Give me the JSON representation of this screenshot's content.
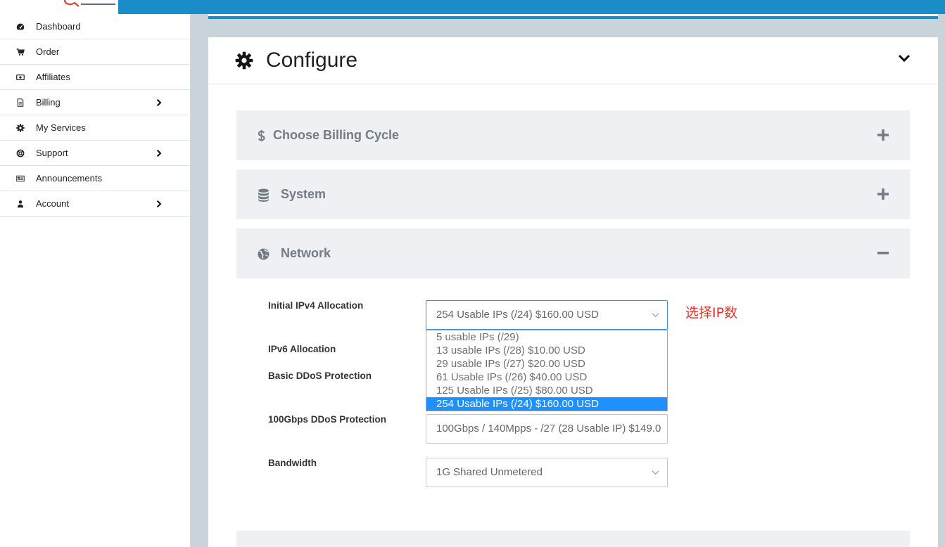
{
  "colors": {
    "topbar": "#1a8cc7",
    "page_bg": "#c9d3da",
    "section_bg": "#eef0f3",
    "section_text": "#737c86",
    "select_focus_border": "#3a8fcf",
    "option_highlight": "#1e90ff",
    "annotation": "#e8302a"
  },
  "sidebar": {
    "items": [
      {
        "label": "Dashboard",
        "icon": "tachometer-icon",
        "has_submenu": false
      },
      {
        "label": "Order",
        "icon": "cart-icon",
        "has_submenu": false
      },
      {
        "label": "Affiliates",
        "icon": "money-icon",
        "has_submenu": false
      },
      {
        "label": "Billing",
        "icon": "file-icon",
        "has_submenu": true
      },
      {
        "label": "My Services",
        "icon": "cog-icon",
        "has_submenu": false
      },
      {
        "label": "Support",
        "icon": "life-ring-icon",
        "has_submenu": true
      },
      {
        "label": "Announcements",
        "icon": "newspaper-icon",
        "has_submenu": false
      },
      {
        "label": "Account",
        "icon": "user-icon",
        "has_submenu": true
      }
    ]
  },
  "configure_panel": {
    "title": "Configure",
    "icon": "gear-icon",
    "toggle_icon": "chevron-down-icon"
  },
  "sections": [
    {
      "title": "Choose Billing Cycle",
      "icon": "dollar-icon",
      "expanded": false,
      "toggle_icon": "plus-icon"
    },
    {
      "title": "System",
      "icon": "database-icon",
      "expanded": false,
      "toggle_icon": "plus-icon"
    },
    {
      "title": "Network",
      "icon": "globe-icon",
      "expanded": true,
      "toggle_icon": "minus-icon"
    }
  ],
  "network": {
    "ipv4": {
      "label": "Initial IPv4 Allocation",
      "value": "254 Usable IPs (/24) $160.00 USD",
      "dropdown_open": true,
      "options": [
        {
          "label": "5 usable IPs (/29)",
          "selected": false
        },
        {
          "label": "13 usable IPs (/28) $10.00 USD",
          "selected": false
        },
        {
          "label": "29 usable IPs (/27) $20.00 USD",
          "selected": false
        },
        {
          "label": "61 Usable IPs (/26) $40.00 USD",
          "selected": false
        },
        {
          "label": "125 Usable IPs (/25) $80.00 USD",
          "selected": false
        },
        {
          "label": "254 Usable IPs (/24) $160.00 USD",
          "selected": true
        }
      ]
    },
    "ipv6": {
      "label": "IPv6 Allocation"
    },
    "basic_ddos": {
      "label": "Basic DDoS Protection"
    },
    "ddos_100g": {
      "label": "100Gbps DDoS Protection",
      "value": "100Gbps / 140Mpps - /27 (28 Usable IP) $149.0"
    },
    "bandwidth": {
      "label": "Bandwidth",
      "value": "1G Shared Unmetered"
    }
  },
  "annotation": {
    "text": "选择IP数"
  }
}
